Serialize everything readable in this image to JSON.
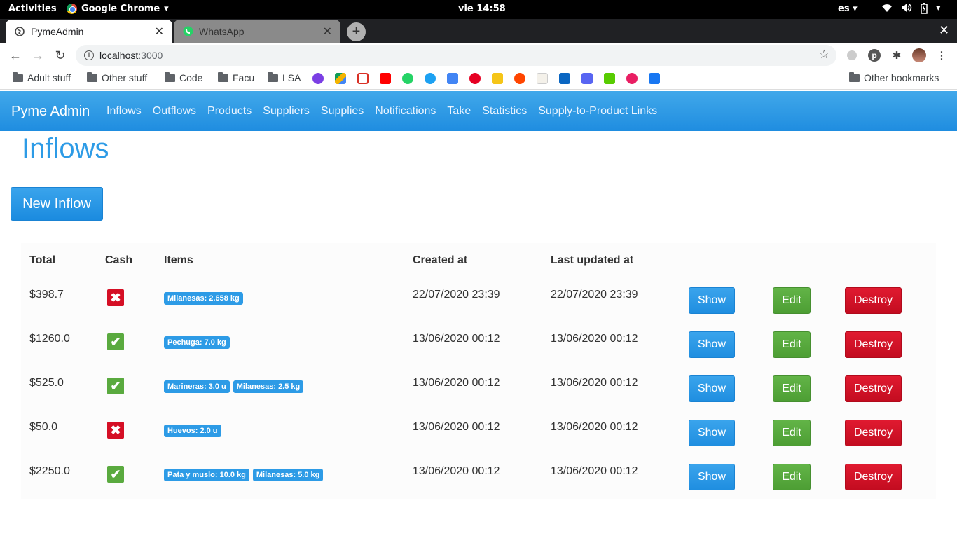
{
  "system": {
    "activities": "Activities",
    "app_menu": "Google Chrome",
    "clock": "vie 14:58",
    "lang": "es"
  },
  "browser": {
    "tabs": [
      {
        "title": "PymeAdmin"
      },
      {
        "title": "WhatsApp"
      }
    ],
    "url_host": "localhost",
    "url_port": ":3000",
    "bookmarks": [
      {
        "label": "Adult stuff"
      },
      {
        "label": "Other stuff"
      },
      {
        "label": "Code"
      },
      {
        "label": "Facu"
      },
      {
        "label": "LSA"
      }
    ],
    "other_bookmarks": "Other bookmarks"
  },
  "app": {
    "brand": "Pyme Admin",
    "nav": [
      "Inflows",
      "Outflows",
      "Products",
      "Suppliers",
      "Supplies",
      "Notifications",
      "Take",
      "Statistics",
      "Supply-to-Product Links"
    ],
    "page_title": "Inflows",
    "new_button": "New Inflow",
    "columns": {
      "total": "Total",
      "cash": "Cash",
      "items": "Items",
      "created": "Created at",
      "updated": "Last updated at"
    },
    "actions": {
      "show": "Show",
      "edit": "Edit",
      "destroy": "Destroy"
    },
    "rows": [
      {
        "total": "$398.7",
        "cash": false,
        "items": [
          "Milanesas: 2.658 kg"
        ],
        "created": "22/07/2020 23:39",
        "updated": "22/07/2020 23:39"
      },
      {
        "total": "$1260.0",
        "cash": true,
        "items": [
          "Pechuga: 7.0 kg"
        ],
        "created": "13/06/2020 00:12",
        "updated": "13/06/2020 00:12"
      },
      {
        "total": "$525.0",
        "cash": true,
        "items": [
          "Marineras: 3.0 u",
          "Milanesas: 2.5 kg"
        ],
        "created": "13/06/2020 00:12",
        "updated": "13/06/2020 00:12"
      },
      {
        "total": "$50.0",
        "cash": false,
        "items": [
          "Huevos: 2.0 u"
        ],
        "created": "13/06/2020 00:12",
        "updated": "13/06/2020 00:12"
      },
      {
        "total": "$2250.0",
        "cash": true,
        "items": [
          "Pata y muslo: 10.0 kg",
          "Milanesas: 5.0 kg"
        ],
        "created": "13/06/2020 00:12",
        "updated": "13/06/2020 00:12"
      }
    ]
  },
  "colors": {
    "accent": "#2d9be6",
    "success": "#5aaa3f",
    "danger": "#d50f25"
  }
}
